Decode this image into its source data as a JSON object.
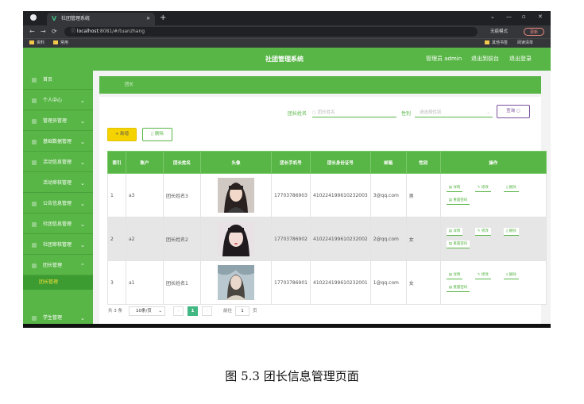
{
  "browser": {
    "tab_title": "社团管理系统",
    "url_host": "localhost",
    "url_rest": ":8081/#/tuanzhang",
    "incognito_label": "无痕模式",
    "update_label": "更新",
    "bookmarks": [
      "资料",
      "常用"
    ],
    "bookmarks_right": [
      "其他书签",
      "阅读清单"
    ]
  },
  "header": {
    "title": "社团管理系统",
    "user_label": "管理员 admin",
    "back_label": "退出到前台",
    "logout_label": "退出登录"
  },
  "sidebar": {
    "items": [
      {
        "label": "首页",
        "arrow": ""
      },
      {
        "label": "个人中心",
        "arrow": "⌄"
      },
      {
        "label": "管理员管理",
        "arrow": "⌄"
      },
      {
        "label": "基础数据管理",
        "arrow": "⌄"
      },
      {
        "label": "活动信息管理",
        "arrow": "⌄"
      },
      {
        "label": "活动审核管理",
        "arrow": "⌄"
      },
      {
        "label": "公告信息管理",
        "arrow": "⌄"
      },
      {
        "label": "社团信息管理",
        "arrow": "⌄"
      },
      {
        "label": "社团审核管理",
        "arrow": "⌄"
      },
      {
        "label": "团长管理",
        "arrow": "⌃"
      },
      {
        "label": "学生管理",
        "arrow": "⌄"
      }
    ],
    "active_sub": "团长管理"
  },
  "breadcrumb": {
    "text": "团长"
  },
  "search": {
    "name_label": "团长姓名",
    "name_placeholder": "团长姓名",
    "gender_label": "性别",
    "gender_placeholder": "请选择性别",
    "query_label": "查询"
  },
  "toolbar": {
    "add_label": "+ 新增",
    "delete_label": "删除"
  },
  "table": {
    "headers": [
      "索引",
      "账户",
      "团长姓名",
      "头像",
      "团长手机号",
      "团长身份证号",
      "邮箱",
      "性别",
      "操作"
    ],
    "rows": [
      {
        "index": "1",
        "account": "a3",
        "name": "团长姓名3",
        "phone": "17703786903",
        "idcard": "410224199610232003",
        "email": "3@qq.com",
        "gender": "男"
      },
      {
        "index": "2",
        "account": "a2",
        "name": "团长姓名2",
        "phone": "17703786902",
        "idcard": "410224199610232002",
        "email": "2@qq.com",
        "gender": "女"
      },
      {
        "index": "3",
        "account": "a1",
        "name": "团长姓名1",
        "phone": "17703786901",
        "idcard": "410224199610232001",
        "email": "1@qq.com",
        "gender": "女"
      }
    ],
    "ops": {
      "detail": "详情",
      "edit": "修改",
      "delete": "删除",
      "reset": "重置密码"
    }
  },
  "pagination": {
    "total_label": "共 3 条",
    "page_size": "10条/页",
    "current": "1",
    "goto_label": "前往",
    "goto_value": "1",
    "page_suffix": "页"
  },
  "caption": "图 5.3  团长信息管理页面",
  "colors": {
    "primary": "#58b646",
    "add_button": "#f5d300",
    "query_button": "#7a4f9c",
    "pager_active": "#41b883"
  }
}
